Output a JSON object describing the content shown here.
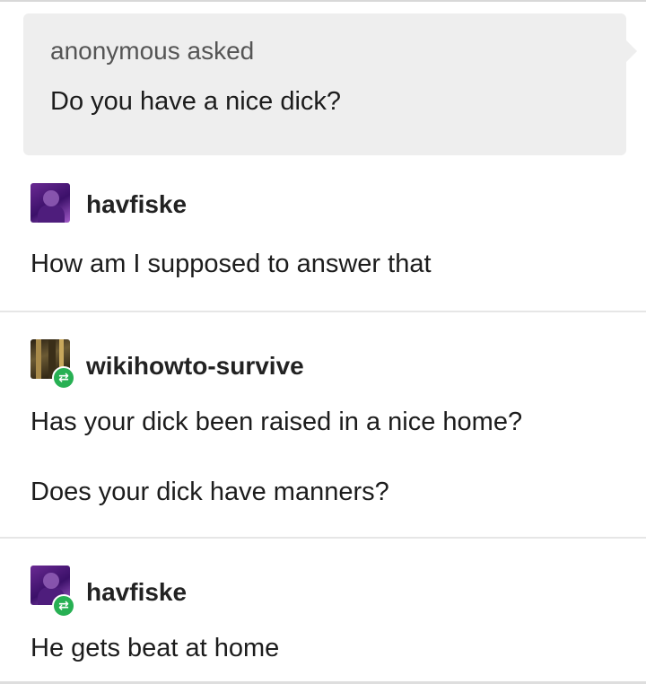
{
  "ask": {
    "asker": "anonymous asked",
    "question": "Do you have a nice dick?"
  },
  "replies": [
    {
      "username": "havfiske",
      "avatar_icon": "avatar-purple",
      "reblogged": false,
      "lines": [
        "How am I supposed to answer that"
      ]
    },
    {
      "username": "wikihowto-survive",
      "avatar_icon": "avatar-dark",
      "reblogged": true,
      "lines": [
        "Has your dick been raised in a nice home?",
        "Does your dick have manners?"
      ]
    },
    {
      "username": "havfiske",
      "avatar_icon": "avatar-purple",
      "reblogged": true,
      "lines": [
        "He gets beat at home"
      ]
    }
  ],
  "colors": {
    "ask_background": "#eeeeee",
    "reblog_badge": "#27b053",
    "divider": "#e6e6e6"
  },
  "icons": {
    "reblog": "reblog-icon",
    "reblog_glyph": "⇄"
  }
}
